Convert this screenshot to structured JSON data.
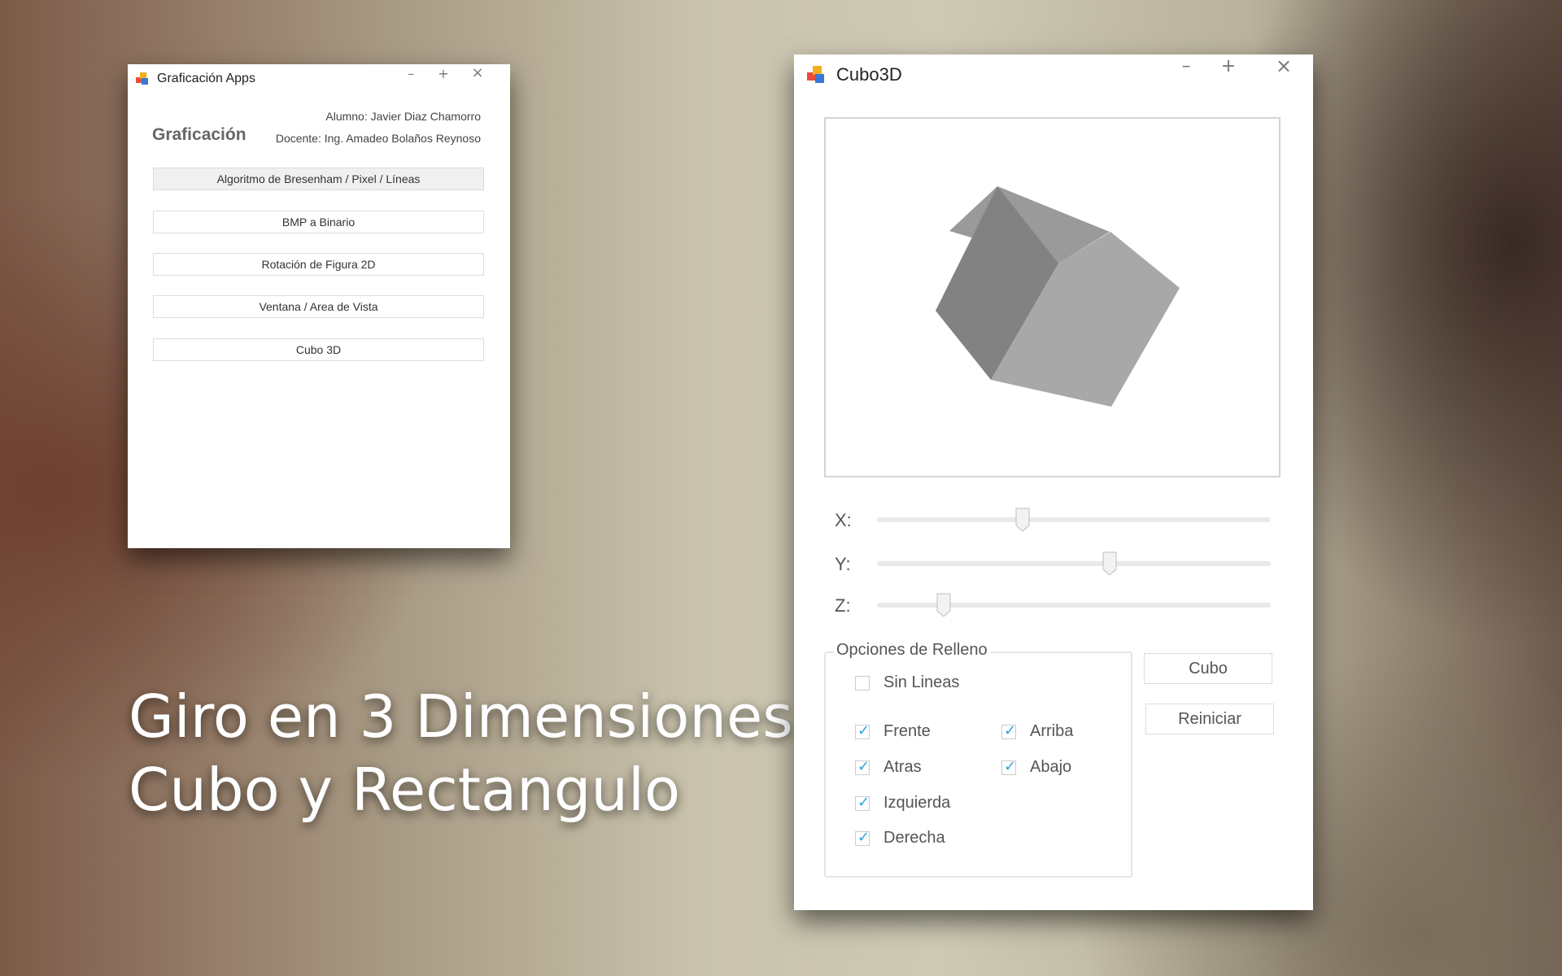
{
  "overlay": {
    "line1": "Giro en 3 Dimensiones",
    "line2": "Cubo y Rectangulo"
  },
  "window1": {
    "title": "Graficación Apps",
    "icon": "app-windows-icon",
    "heading": "Graficación",
    "alumno": "Alumno: Javier Diaz Chamorro",
    "docente": "Docente: Ing. Amadeo Bolaños  Reynoso",
    "buttons": [
      "Algoritmo de Bresenham / Pixel / Líneas",
      "BMP a Binario",
      "Rotación de Figura 2D",
      "Ventana / Area de Vista",
      "Cubo 3D"
    ],
    "controls": {
      "minimize": "–",
      "maximize": "+",
      "close": "×"
    }
  },
  "window2": {
    "title": "Cubo3D",
    "icon": "app-windows-icon",
    "controls": {
      "minimize": "–",
      "maximize": "+",
      "close": "×"
    },
    "sliders": [
      {
        "label": "X:",
        "value": 0.37
      },
      {
        "label": "Y:",
        "value": 0.59
      },
      {
        "label": "Z:",
        "value": 0.17
      }
    ],
    "group_title": "Opciones de Relleno",
    "sin_lineas": {
      "label": "Sin Lineas",
      "checked": false
    },
    "faces": [
      {
        "label": "Frente",
        "checked": true
      },
      {
        "label": "Atras",
        "checked": true
      },
      {
        "label": "Izquierda",
        "checked": true
      },
      {
        "label": "Derecha",
        "checked": true
      },
      {
        "label": "Arriba",
        "checked": true
      },
      {
        "label": "Abajo",
        "checked": true
      }
    ],
    "btn_cubo": "Cubo",
    "btn_reiniciar": "Reiniciar",
    "colors": {
      "face_dark": "#828282",
      "face_light": "#a8a8a8",
      "check": "#2aa6d6"
    }
  }
}
